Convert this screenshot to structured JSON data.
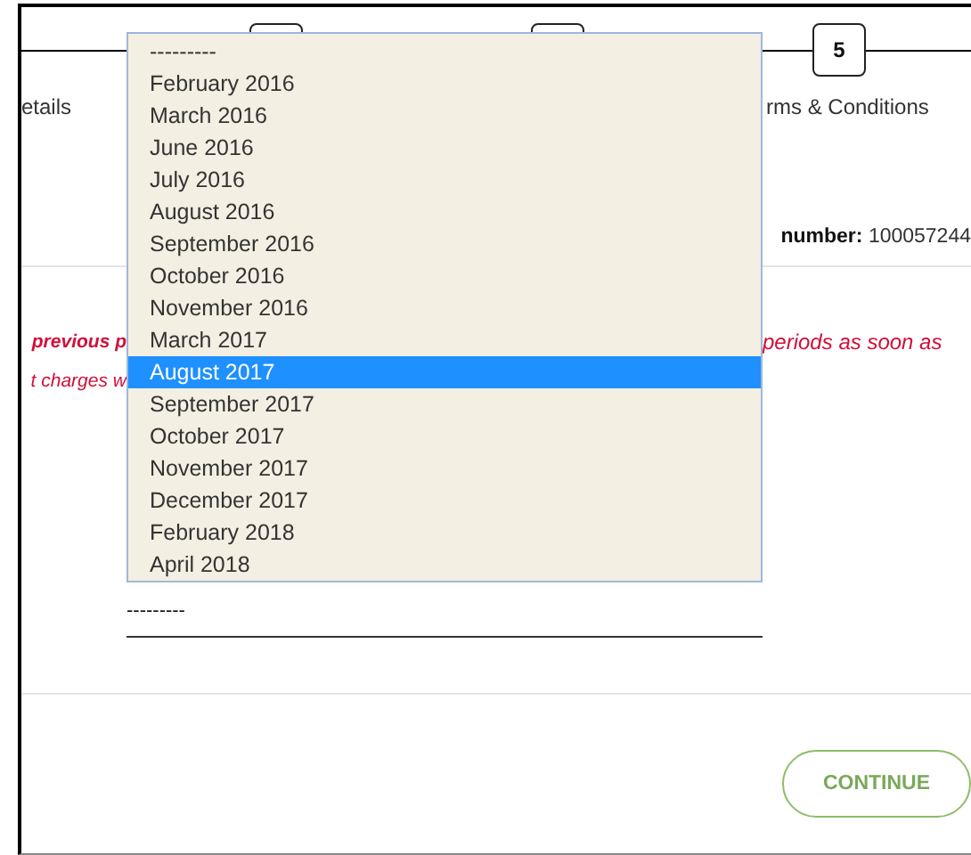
{
  "stepper": {
    "steps": [
      {
        "kind": "label",
        "label": "etails"
      },
      {
        "kind": "box"
      },
      {
        "kind": "box"
      },
      {
        "kind": "box",
        "number": "5",
        "label": "rms & Conditions"
      }
    ]
  },
  "account": {
    "label": "number:",
    "value": "100057244"
  },
  "notice": {
    "left_lines": [
      "**previous p**",
      "t charges w"
    ],
    "right_lines": [
      "periods as soon as"
    ]
  },
  "period_field": {
    "value": "---------"
  },
  "dropdown": {
    "options": [
      {
        "label": "---------",
        "selected": false
      },
      {
        "label": "February 2016",
        "selected": false
      },
      {
        "label": "March 2016",
        "selected": false
      },
      {
        "label": "June 2016",
        "selected": false
      },
      {
        "label": "July 2016",
        "selected": false
      },
      {
        "label": "August 2016",
        "selected": false
      },
      {
        "label": "September 2016",
        "selected": false
      },
      {
        "label": "October 2016",
        "selected": false
      },
      {
        "label": "November 2016",
        "selected": false
      },
      {
        "label": "March 2017",
        "selected": false
      },
      {
        "label": "August 2017",
        "selected": true
      },
      {
        "label": "September 2017",
        "selected": false
      },
      {
        "label": "October 2017",
        "selected": false
      },
      {
        "label": "November 2017",
        "selected": false
      },
      {
        "label": "December 2017",
        "selected": false
      },
      {
        "label": "February 2018",
        "selected": false
      },
      {
        "label": "April 2018",
        "selected": false
      }
    ]
  },
  "continue_button": {
    "label": "CONTINUE"
  }
}
